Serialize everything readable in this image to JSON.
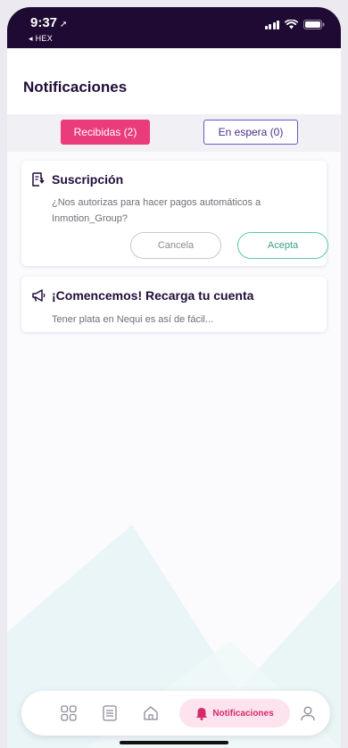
{
  "status_bar": {
    "time": "9:37",
    "back_app": "◂ HEX"
  },
  "header": {
    "title": "Notificaciones"
  },
  "tabs": [
    {
      "label": "Recibidas (2)",
      "active": true
    },
    {
      "label": "En espera (0)",
      "active": false
    }
  ],
  "notifications": [
    {
      "icon": "subscription-icon",
      "title": "Suscripción",
      "body": "¿Nos autorizas para hacer pagos automáticos a Inmotion_Group?",
      "cancel_label": "Cancela",
      "accept_label": "Acepta"
    },
    {
      "icon": "megaphone-icon",
      "title": "¡Comencemos! Recarga tu cuenta",
      "body": "Tener plata en Nequi es así de fácil..."
    }
  ],
  "bottom_nav": {
    "items": [
      "grid-icon",
      "list-icon",
      "home-icon",
      "bell-icon",
      "profile-icon"
    ],
    "active_label": "Notificaciones"
  },
  "colors": {
    "status_bar": "#1e0a33",
    "accent_pink": "#ea3b7a",
    "purple": "#6c55c4",
    "accept_green": "#5cc9a9"
  }
}
